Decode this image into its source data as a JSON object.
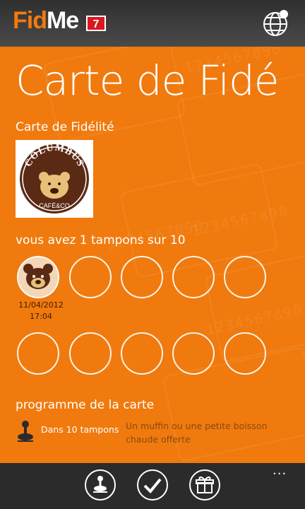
{
  "header": {
    "logo_fid": "Fid",
    "logo_me": "Me",
    "badge_count": "7",
    "globe_icon": "globe-icon"
  },
  "page": {
    "title": "Carte de Fidé",
    "card_label": "Carte de Fidélité",
    "brand": {
      "name_text": "COLUMBUS",
      "sub_text": "CAFÉ&CO"
    },
    "stamps_text": "vous avez 1 tampons sur 10",
    "stamps": {
      "collected": 1,
      "total": 10,
      "first_date": "11/04/2012",
      "first_time": "17:04"
    },
    "program_label": "programme de la carte",
    "reward": {
      "condition": "Dans 10 tampons",
      "description": "Un muffin ou une petite boisson chaude offerte",
      "icon": "joystick-icon"
    }
  },
  "appbar": {
    "more_label": "...",
    "buttons": [
      "joystick-icon",
      "check-icon",
      "gift-icon"
    ]
  },
  "colors": {
    "background": "#F07A0E",
    "topbar": "#3a3a3a",
    "badge": "#D71920",
    "appbar": "#2b2b2b"
  }
}
